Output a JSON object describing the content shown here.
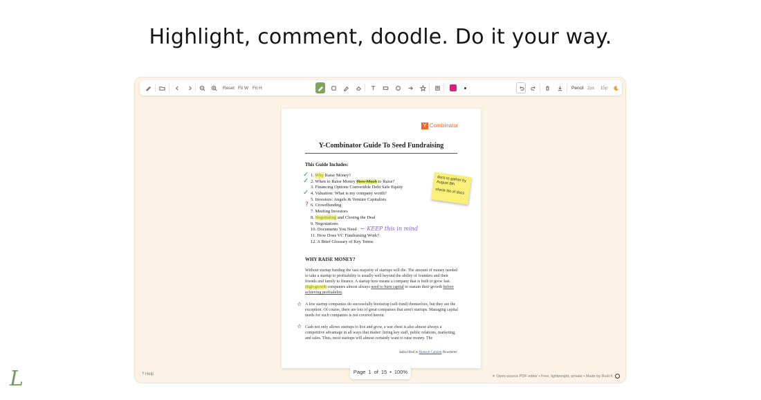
{
  "headline": "Highlight, comment, doodle. Do it your way.",
  "toolbar": {
    "reset": "Reset",
    "fit_w": "Fit W",
    "fit_h": "Fit H",
    "tool_name": "Pencil",
    "stroke_size": "2px",
    "font_size": "15p",
    "active_color": "#d6237a"
  },
  "document": {
    "brand_badge": "Y",
    "brand_text": "Combinator",
    "title": "Y-Combinator Guide To Seed Fundraising",
    "guide_heading": "This Guide Includes:",
    "toc": [
      {
        "num": "1.",
        "pre": "",
        "hl": "Why",
        "post": " Raise Money?"
      },
      {
        "num": "2.",
        "pre": "When to Raise Money ",
        "hl": "How Much",
        "post": " to Raise?"
      },
      {
        "num": "3.",
        "pre": "Financing Options Convertible Debt Safe Equity",
        "hl": "",
        "post": ""
      },
      {
        "num": "4.",
        "pre": "Valuation: What is my company worth?",
        "hl": "",
        "post": ""
      },
      {
        "num": "5.",
        "pre": "Investors: Angels & Venture Capitalists",
        "hl": "",
        "post": ""
      },
      {
        "num": "6.",
        "pre": "Crowdfunding",
        "hl": "",
        "post": ""
      },
      {
        "num": "7.",
        "pre": "Meeting Investors",
        "hl": "",
        "post": ""
      },
      {
        "num": "8.",
        "pre": "",
        "hl": "Negotiating",
        "post": " and Closing the Deal"
      },
      {
        "num": "9.",
        "pre": "Negotiations",
        "hl": "",
        "post": ""
      },
      {
        "num": "10.",
        "pre": "Documents You Need",
        "hl": "",
        "post": ""
      },
      {
        "num": "11.",
        "pre": "How Does VC Fundraising Work?",
        "hl": "",
        "post": ""
      },
      {
        "num": "12.",
        "pre": "A Brief Glossary of Key Terms",
        "hl": "",
        "post": ""
      }
    ],
    "handwritten_note": "← KEEP this in mind",
    "sticky_line1": "docs to gather by August 8th",
    "sticky_line2": "check list of docs",
    "section_heading": "WHY RAISE MONEY?",
    "para1_a": "Without startup funding the vast majority of startups will die. The amount of money needed to take a startup to profitability is usually well beyond the ability of founders and their friends and family to finance. A startup here means a company that is built to grow fast. ",
    "para1_hl": "High-growth",
    "para1_b": " companies almost always ",
    "para1_ul1": "need to burn capital",
    "para1_c": " to sustain their growth ",
    "para1_ul2": "before achieving profitability",
    "para1_d": ".",
    "para2": "A few startup companies do successfully bootstrap (self-fund) themselves, but they are the exception. Of course, there are lots of great companies that aren't startups. Managing capital needs for such companies is not covered herein.",
    "para3": "Cash not only allows startups to live and grow, a war chest is also almost always a competitive advantage in all ways that matter: hiring key staff, public relations, marketing, and sales. Thus, most startups will almost certainly want to raise money. The",
    "footer_pre": "Subscribed to ",
    "footer_link": "Hanson Catamit",
    "footer_post": " Newsletter"
  },
  "pager": {
    "label": "Page",
    "current": "1",
    "of": "of",
    "total": "15",
    "zoom": "100%"
  },
  "footer": {
    "help": "? Help",
    "made_by": "☀ Open-source PDF editor • Free, lightweight, private • Made by Rudi K"
  }
}
